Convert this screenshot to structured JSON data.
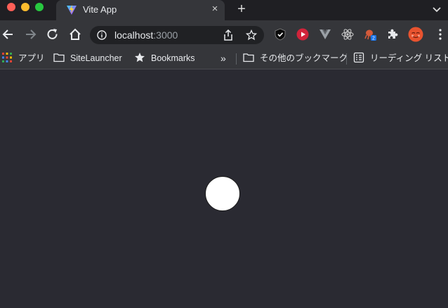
{
  "window": {
    "tab": {
      "title": "Vite App",
      "favicon": "vite-logo-icon",
      "close": "×"
    },
    "new_tab": "+"
  },
  "toolbar": {
    "url_host": "localhost",
    "url_port": ":3000",
    "extensions": [
      "shield-extension-icon",
      "play-extension-icon",
      "vue-devtools-icon",
      "react-devtools-icon",
      "octopus-extension-icon",
      "puzzle-extensions-icon"
    ],
    "extension_badge": "2"
  },
  "bookmarks": {
    "apps": "アプリ",
    "site_launcher": "SiteLauncher",
    "bookmarks": "Bookmarks",
    "more": "»",
    "other": "その他のブックマーク",
    "reading_list": "リーディング リスト"
  },
  "colors": {
    "page_background": "#2a2a32",
    "circle_fill": "#ffffff",
    "chrome_toolbar": "#35363a"
  }
}
